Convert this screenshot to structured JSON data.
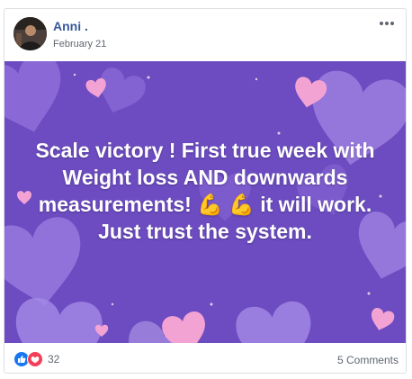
{
  "post": {
    "author": "Anni .",
    "date": "February 21",
    "text": "Scale victory ! First true week with Weight loss AND downwards measurements! 💪 💪 it will work. Just trust the system.",
    "reaction_count": "32",
    "comments_label": "5 Comments"
  },
  "icons": {
    "options": "more-options-icon",
    "like": "like-reaction-icon",
    "love": "love-reaction-icon"
  },
  "colors": {
    "background_purple": "#6c4cc0",
    "heart_pink": "#f3a3d3",
    "heart_lavender": "#a58ae6",
    "link_blue": "#385898",
    "like_blue": "#1877f2",
    "love_red": "#f33e58"
  }
}
